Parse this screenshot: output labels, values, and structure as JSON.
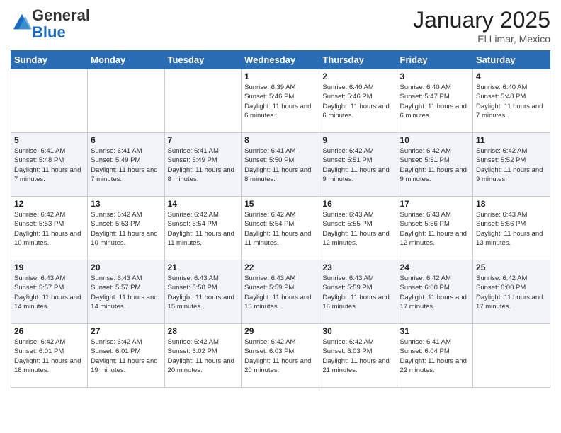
{
  "logo": {
    "general": "General",
    "blue": "Blue"
  },
  "header": {
    "month": "January 2025",
    "location": "El Limar, Mexico"
  },
  "weekdays": [
    "Sunday",
    "Monday",
    "Tuesday",
    "Wednesday",
    "Thursday",
    "Friday",
    "Saturday"
  ],
  "weeks": [
    [
      {
        "day": "",
        "info": ""
      },
      {
        "day": "",
        "info": ""
      },
      {
        "day": "",
        "info": ""
      },
      {
        "day": "1",
        "info": "Sunrise: 6:39 AM\nSunset: 5:46 PM\nDaylight: 11 hours and 6 minutes."
      },
      {
        "day": "2",
        "info": "Sunrise: 6:40 AM\nSunset: 5:46 PM\nDaylight: 11 hours and 6 minutes."
      },
      {
        "day": "3",
        "info": "Sunrise: 6:40 AM\nSunset: 5:47 PM\nDaylight: 11 hours and 6 minutes."
      },
      {
        "day": "4",
        "info": "Sunrise: 6:40 AM\nSunset: 5:48 PM\nDaylight: 11 hours and 7 minutes."
      }
    ],
    [
      {
        "day": "5",
        "info": "Sunrise: 6:41 AM\nSunset: 5:48 PM\nDaylight: 11 hours and 7 minutes."
      },
      {
        "day": "6",
        "info": "Sunrise: 6:41 AM\nSunset: 5:49 PM\nDaylight: 11 hours and 7 minutes."
      },
      {
        "day": "7",
        "info": "Sunrise: 6:41 AM\nSunset: 5:49 PM\nDaylight: 11 hours and 8 minutes."
      },
      {
        "day": "8",
        "info": "Sunrise: 6:41 AM\nSunset: 5:50 PM\nDaylight: 11 hours and 8 minutes."
      },
      {
        "day": "9",
        "info": "Sunrise: 6:42 AM\nSunset: 5:51 PM\nDaylight: 11 hours and 9 minutes."
      },
      {
        "day": "10",
        "info": "Sunrise: 6:42 AM\nSunset: 5:51 PM\nDaylight: 11 hours and 9 minutes."
      },
      {
        "day": "11",
        "info": "Sunrise: 6:42 AM\nSunset: 5:52 PM\nDaylight: 11 hours and 9 minutes."
      }
    ],
    [
      {
        "day": "12",
        "info": "Sunrise: 6:42 AM\nSunset: 5:53 PM\nDaylight: 11 hours and 10 minutes."
      },
      {
        "day": "13",
        "info": "Sunrise: 6:42 AM\nSunset: 5:53 PM\nDaylight: 11 hours and 10 minutes."
      },
      {
        "day": "14",
        "info": "Sunrise: 6:42 AM\nSunset: 5:54 PM\nDaylight: 11 hours and 11 minutes."
      },
      {
        "day": "15",
        "info": "Sunrise: 6:42 AM\nSunset: 5:54 PM\nDaylight: 11 hours and 11 minutes."
      },
      {
        "day": "16",
        "info": "Sunrise: 6:43 AM\nSunset: 5:55 PM\nDaylight: 11 hours and 12 minutes."
      },
      {
        "day": "17",
        "info": "Sunrise: 6:43 AM\nSunset: 5:56 PM\nDaylight: 11 hours and 12 minutes."
      },
      {
        "day": "18",
        "info": "Sunrise: 6:43 AM\nSunset: 5:56 PM\nDaylight: 11 hours and 13 minutes."
      }
    ],
    [
      {
        "day": "19",
        "info": "Sunrise: 6:43 AM\nSunset: 5:57 PM\nDaylight: 11 hours and 14 minutes."
      },
      {
        "day": "20",
        "info": "Sunrise: 6:43 AM\nSunset: 5:57 PM\nDaylight: 11 hours and 14 minutes."
      },
      {
        "day": "21",
        "info": "Sunrise: 6:43 AM\nSunset: 5:58 PM\nDaylight: 11 hours and 15 minutes."
      },
      {
        "day": "22",
        "info": "Sunrise: 6:43 AM\nSunset: 5:59 PM\nDaylight: 11 hours and 15 minutes."
      },
      {
        "day": "23",
        "info": "Sunrise: 6:43 AM\nSunset: 5:59 PM\nDaylight: 11 hours and 16 minutes."
      },
      {
        "day": "24",
        "info": "Sunrise: 6:42 AM\nSunset: 6:00 PM\nDaylight: 11 hours and 17 minutes."
      },
      {
        "day": "25",
        "info": "Sunrise: 6:42 AM\nSunset: 6:00 PM\nDaylight: 11 hours and 17 minutes."
      }
    ],
    [
      {
        "day": "26",
        "info": "Sunrise: 6:42 AM\nSunset: 6:01 PM\nDaylight: 11 hours and 18 minutes."
      },
      {
        "day": "27",
        "info": "Sunrise: 6:42 AM\nSunset: 6:01 PM\nDaylight: 11 hours and 19 minutes."
      },
      {
        "day": "28",
        "info": "Sunrise: 6:42 AM\nSunset: 6:02 PM\nDaylight: 11 hours and 20 minutes."
      },
      {
        "day": "29",
        "info": "Sunrise: 6:42 AM\nSunset: 6:03 PM\nDaylight: 11 hours and 20 minutes."
      },
      {
        "day": "30",
        "info": "Sunrise: 6:42 AM\nSunset: 6:03 PM\nDaylight: 11 hours and 21 minutes."
      },
      {
        "day": "31",
        "info": "Sunrise: 6:41 AM\nSunset: 6:04 PM\nDaylight: 11 hours and 22 minutes."
      },
      {
        "day": "",
        "info": ""
      }
    ]
  ]
}
